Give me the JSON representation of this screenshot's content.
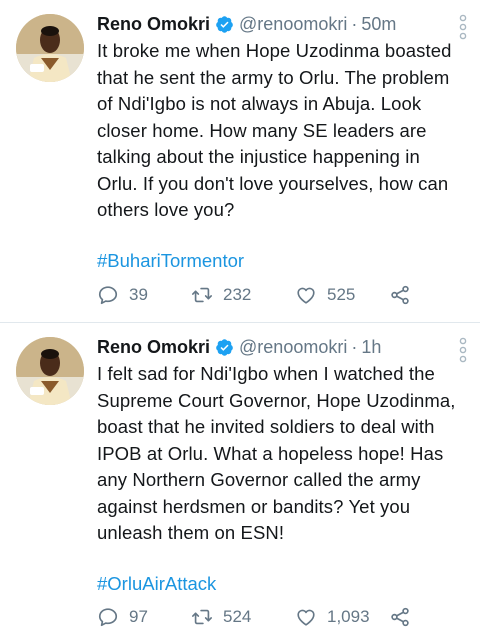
{
  "tweets": [
    {
      "name": "Reno Omokri",
      "handle": "@renoomokri",
      "separator": "·",
      "time": "50m",
      "text": "It broke me when Hope Uzodinma boasted that he sent the army to Orlu. The problem of Ndi'Igbo is not always in Abuja. Look closer home. How many SE leaders are talking about the injustice happening in Orlu. If you don't love yourselves, how can others love you?",
      "hashtag": "#BuhariTormentor",
      "replies": "39",
      "retweets": "232",
      "likes": "525"
    },
    {
      "name": "Reno Omokri",
      "handle": "@renoomokri",
      "separator": "·",
      "time": "1h",
      "text": "I felt sad for Ndi'Igbo when I watched the Supreme Court Governor, Hope Uzodinma, boast that he invited soldiers to deal with IPOB at Orlu. What a hopeless hope! Has any Northern Governor called the army against herdsmen or bandits? Yet you unleash them on ESN!",
      "hashtag": "#OrluAirAttack",
      "replies": "97",
      "retweets": "524",
      "likes": "1,093"
    }
  ],
  "colors": {
    "accent": "#1b95e0",
    "verified": "#1da1f2",
    "muted": "#657786",
    "divider": "#e1e8ed"
  },
  "icons": [
    "verified-badge-icon",
    "more-vertical-icon",
    "reply-icon",
    "retweet-icon",
    "like-icon",
    "share-icon"
  ]
}
